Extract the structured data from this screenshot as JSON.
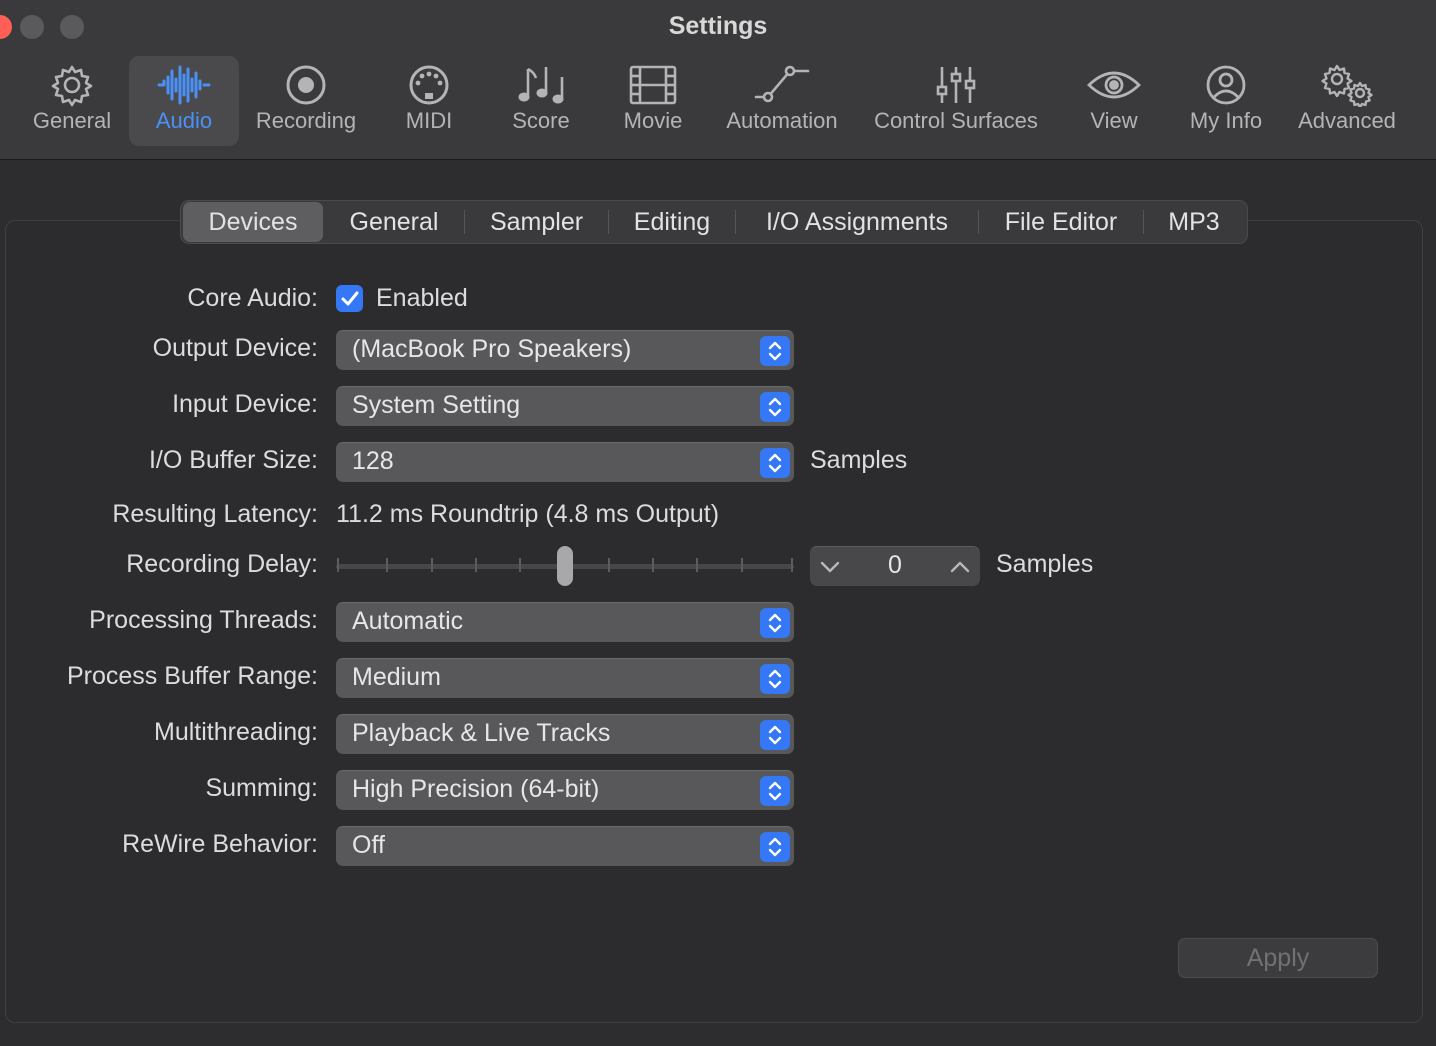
{
  "window": {
    "title": "Settings"
  },
  "toolbar": {
    "items": [
      {
        "label": "General",
        "icon": "gear-icon"
      },
      {
        "label": "Audio",
        "icon": "waveform-icon",
        "active": true
      },
      {
        "label": "Recording",
        "icon": "record-icon"
      },
      {
        "label": "MIDI",
        "icon": "midi-connector-icon"
      },
      {
        "label": "Score",
        "icon": "music-notes-icon"
      },
      {
        "label": "Movie",
        "icon": "film-icon"
      },
      {
        "label": "Automation",
        "icon": "automation-curve-icon"
      },
      {
        "label": "Control Surfaces",
        "icon": "faders-icon"
      },
      {
        "label": "View",
        "icon": "eye-icon"
      },
      {
        "label": "My Info",
        "icon": "person-icon"
      },
      {
        "label": "Advanced",
        "icon": "gears-icon"
      }
    ]
  },
  "tabs": [
    {
      "label": "Devices",
      "active": true
    },
    {
      "label": "General"
    },
    {
      "label": "Sampler"
    },
    {
      "label": "Editing"
    },
    {
      "label": "I/O Assignments"
    },
    {
      "label": "File Editor"
    },
    {
      "label": "MP3"
    }
  ],
  "form": {
    "core_audio": {
      "label": "Core Audio:",
      "checkbox_label": "Enabled",
      "checked": true
    },
    "output_device": {
      "label": "Output Device:",
      "value": "(MacBook Pro Speakers)"
    },
    "input_device": {
      "label": "Input Device:",
      "value": "System Setting"
    },
    "buffer_size": {
      "label": "I/O Buffer Size:",
      "value": "128",
      "unit": "Samples"
    },
    "latency": {
      "label": "Resulting Latency:",
      "value": "11.2 ms Roundtrip (4.8 ms Output)"
    },
    "recording_delay": {
      "label": "Recording Delay:",
      "value": "0",
      "unit": "Samples",
      "slider_position": 0.5
    },
    "processing_threads": {
      "label": "Processing Threads:",
      "value": "Automatic"
    },
    "process_buffer_range": {
      "label": "Process Buffer Range:",
      "value": "Medium"
    },
    "multithreading": {
      "label": "Multithreading:",
      "value": "Playback & Live Tracks"
    },
    "summing": {
      "label": "Summing:",
      "value": "High Precision (64-bit)"
    },
    "rewire": {
      "label": "ReWire Behavior:",
      "value": "Off"
    }
  },
  "apply_label": "Apply",
  "colors": {
    "accent": "#3478f6",
    "active_label": "#4a90f6"
  }
}
